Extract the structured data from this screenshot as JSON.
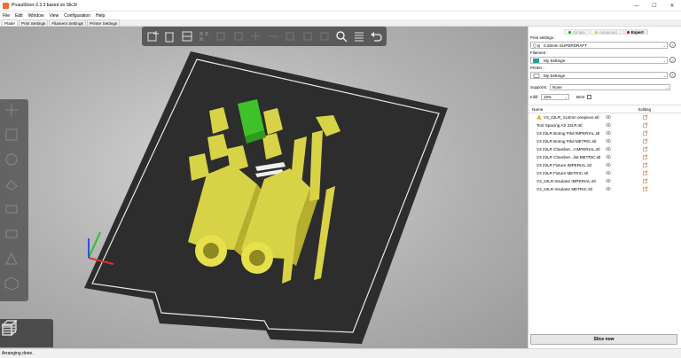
{
  "window": {
    "title": "PrusaSlicer-2.3.3 based on Slic3r",
    "minimize": "—",
    "maximize": "☐",
    "close": "✕"
  },
  "menu": [
    "File",
    "Edit",
    "Window",
    "View",
    "Configuration",
    "Help"
  ],
  "tabs": [
    {
      "label": "Plater",
      "active": true
    },
    {
      "label": "Print Settings",
      "active": false
    },
    {
      "label": "Filament Settings",
      "active": false
    },
    {
      "label": "Printer Settings",
      "active": false
    }
  ],
  "modes": [
    {
      "label": "Simple",
      "color": "#00b000",
      "active": false
    },
    {
      "label": "Advanced",
      "color": "#fac800",
      "active": false
    },
    {
      "label": "Expert",
      "color": "#e00000",
      "active": true
    }
  ],
  "print_settings": {
    "label": "Print settings :",
    "value": "0.28mm SUPERDRAFT"
  },
  "filament": {
    "label": "Filament :",
    "value": "My Settings",
    "color": "#2a9d8f"
  },
  "printer": {
    "label": "Printer :",
    "value": "My Settings"
  },
  "supports": {
    "label": "Supports:",
    "value": "None"
  },
  "infill": {
    "label": "Infill:",
    "value": "15%"
  },
  "brim": {
    "label": "Brim:"
  },
  "object_list": {
    "col_name": "Name",
    "col_editing": "Editing",
    "items": [
      {
        "name": "V3_22LR_114mm onepiece.stl",
        "warning": true
      },
      {
        "name": "Tool Spacing AS 22LR.stl",
        "warning": false
      },
      {
        "name": "V3 22LR Boring Pilot IMPERIAL.stl",
        "warning": false
      },
      {
        "name": "V3 22LR Boring Pilot METRIC.stl",
        "warning": false
      },
      {
        "name": "V3 22LR Chamber...t IMPERIAL.stl",
        "warning": false
      },
      {
        "name": "V3 22LR Chamber...ilot METRIC.stl",
        "warning": false
      },
      {
        "name": "V3 22LR Fixture IMPERIAL.stl",
        "warning": false
      },
      {
        "name": "V3 22LR Fixture METRIC.stl",
        "warning": false
      },
      {
        "name": "V3_22LR Insulator IMPERIAL.stl",
        "warning": false
      },
      {
        "name": "V3_22LR Insulator METRIC.stl",
        "warning": false
      }
    ]
  },
  "slice_button": "Slice now",
  "status": "Arranging done.",
  "colors": {
    "accent": "#fa6831",
    "model": "#e6e14a",
    "selected": "#3fc12a",
    "bed": "#2d2d2d"
  },
  "toolbar_icons": [
    "add-icon",
    "delete-icon",
    "delete-all-icon",
    "arrange-icon",
    "copy-icon",
    "paste-icon",
    "add-instance-icon",
    "remove-instance-icon",
    "split-objects-icon",
    "split-parts-icon",
    "variable-layer-height-icon",
    "search-icon",
    "layers-icon",
    "undo-icon"
  ],
  "left_tool_icons": [
    "move-icon",
    "scale-icon",
    "rotate-icon",
    "place-on-face-icon",
    "cut-icon",
    "paint-supports-icon",
    "seam-painting-icon",
    "hollow-icon"
  ],
  "view_icons": [
    "3d-view-icon",
    "preview-icon"
  ]
}
